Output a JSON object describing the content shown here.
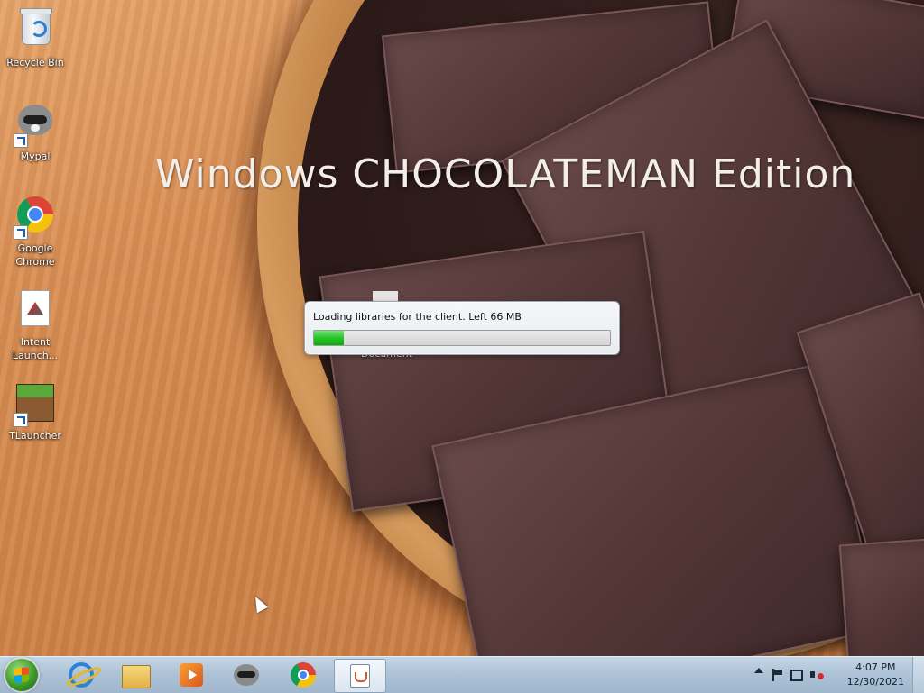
{
  "desktop": {
    "wallpaper_title": "Windows CHOCOLATEMAN Edition",
    "icons": [
      {
        "label_line1": "Recycle Bin",
        "label_line2": "",
        "icon": "recycle-bin-icon"
      },
      {
        "label_line1": "Mypal",
        "label_line2": "",
        "icon": "raccoon-icon"
      },
      {
        "label_line1": "Google",
        "label_line2": "Chrome",
        "icon": "chrome-icon"
      },
      {
        "label_line1": "Intent",
        "label_line2": "Launch...",
        "icon": "document-icon"
      },
      {
        "label_line1": "TLauncher",
        "label_line2": "",
        "icon": "minecraft-grass-icon"
      }
    ],
    "background_file_label": "Document"
  },
  "loading_popup": {
    "message": "Loading libraries for the client. Left 66 MB",
    "progress_fraction": 0.1,
    "progress_color": "#27c427"
  },
  "taskbar": {
    "start_button": "windows-start-icon",
    "pinned": [
      {
        "name": "internet-explorer-icon"
      },
      {
        "name": "file-explorer-icon"
      },
      {
        "name": "media-player-icon"
      },
      {
        "name": "mypal-icon"
      },
      {
        "name": "chrome-icon"
      },
      {
        "name": "java-icon",
        "active": true
      }
    ],
    "tray": {
      "time": "4:07 PM",
      "date": "12/30/2021"
    }
  }
}
